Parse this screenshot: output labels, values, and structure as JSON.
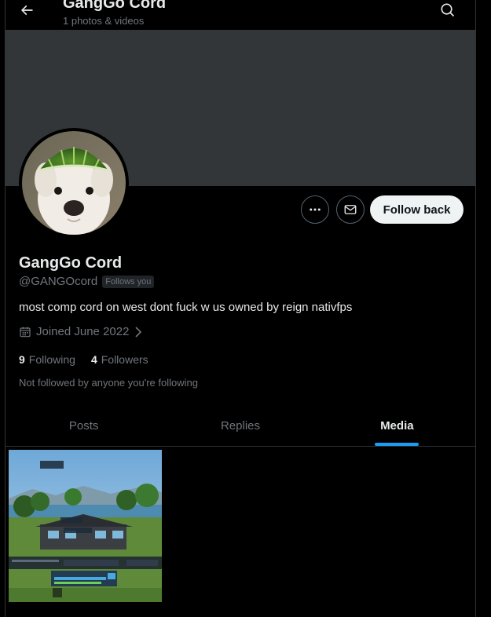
{
  "header": {
    "title": "GangGo Cord",
    "subtitle": "1 photos & videos",
    "back_icon": "arrow-left-icon",
    "search_icon": "search-icon"
  },
  "profile": {
    "display_name": "GangGo Cord",
    "handle": "@GANGOcord",
    "follows_you": "Follows you",
    "bio": "most comp cord on west dont fuck w us owned by reign nativfps",
    "joined": "Joined June 2022",
    "following_count": "9",
    "following_label": "Following",
    "followers_count": "4",
    "followers_label": "Followers",
    "not_followed_text": "Not followed by anyone you're following"
  },
  "actions": {
    "more_icon": "more-icon",
    "message_icon": "mail-icon",
    "follow_back_label": "Follow back"
  },
  "tabs": [
    {
      "label": "Posts",
      "active": false
    },
    {
      "label": "Replies",
      "active": false
    },
    {
      "label": "Media",
      "active": true
    }
  ],
  "media": {
    "count_shown": 1
  },
  "colors": {
    "background": "#000000",
    "banner": "#333639",
    "accent": "#1d9bf0",
    "muted_text": "#71767b",
    "primary_text": "#e7e9ea",
    "follow_button_bg": "#eff3f4"
  }
}
